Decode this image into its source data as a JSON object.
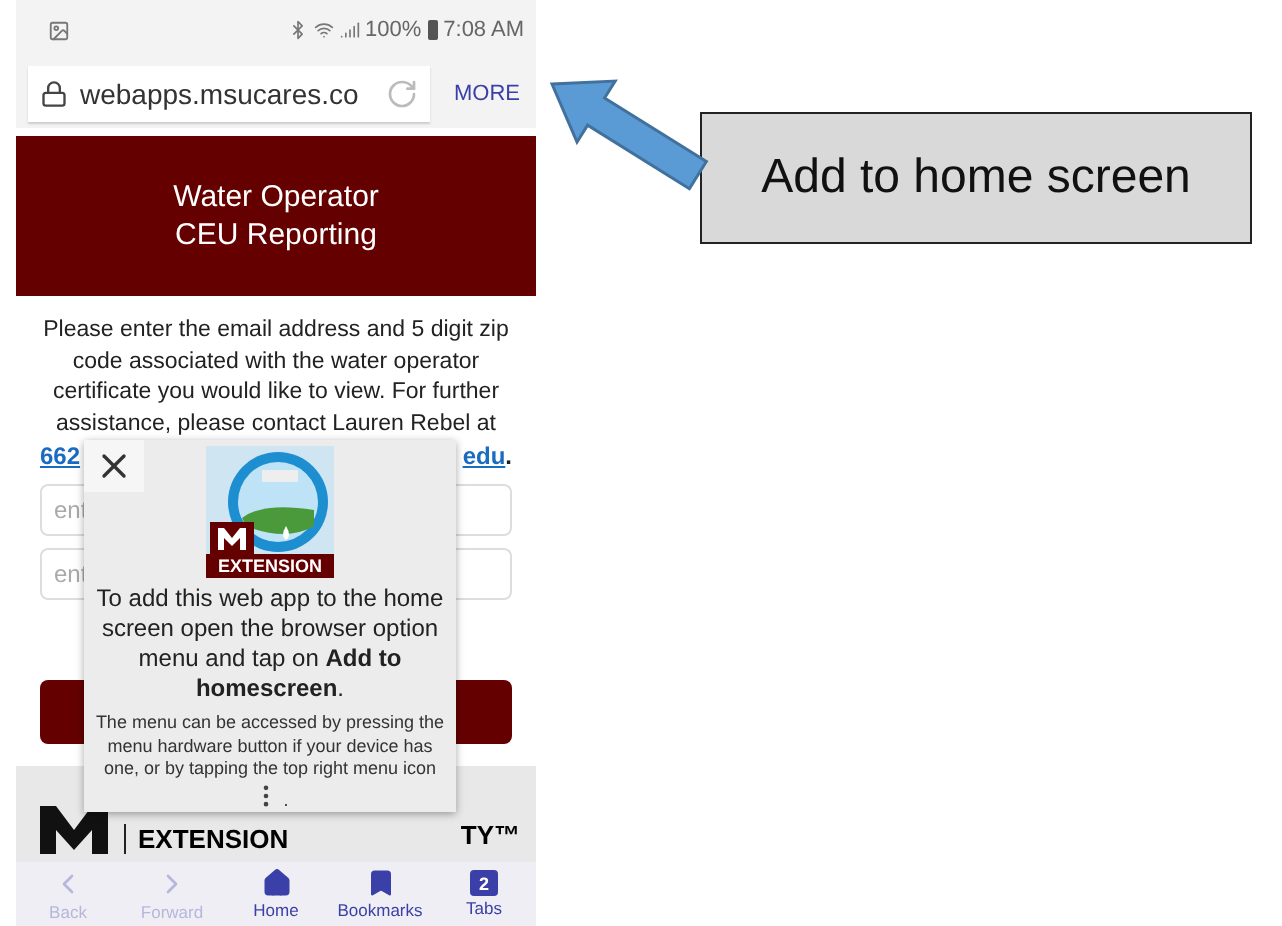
{
  "status_bar": {
    "battery": "100%",
    "time": "7:08 AM"
  },
  "address_bar": {
    "url": "webapps.msucares.co",
    "menu": "MORE"
  },
  "header": {
    "title_lines": [
      "Water Operator",
      "CEU Reporting"
    ]
  },
  "intro": {
    "text": "Please enter the email address and 5 digit zip code associated with the water operator certificate you would like to view. For further assistance, please contact Lauren Rebel at",
    "link_start": "662",
    "link_end": "edu",
    "end": "."
  },
  "fields": [
    {
      "placeholder": "ent"
    },
    {
      "placeholder": "ent"
    }
  ],
  "popup": {
    "badge": "EXTENSION",
    "message": "To add this web app to the home screen open the browser option menu and tap on **Add to homescreen**.",
    "note": "The menu can be accessed by pressing the menu hardware button if your device has one, or by tapping the top right menu icon",
    "note_end": "."
  },
  "footer": {
    "brand": "EXTENSION",
    "university_end": "TY™"
  },
  "nav": [
    {
      "kind": "back",
      "label": "Back",
      "disabled": true
    },
    {
      "kind": "forward",
      "label": "Forward",
      "disabled": true
    },
    {
      "kind": "home",
      "label": "Home",
      "disabled": false
    },
    {
      "kind": "bookmarks",
      "label": "Bookmarks",
      "disabled": false
    },
    {
      "kind": "tabs",
      "label": "Tabs",
      "disabled": false,
      "count": "2"
    }
  ],
  "callout": {
    "text": "Add to home screen"
  }
}
